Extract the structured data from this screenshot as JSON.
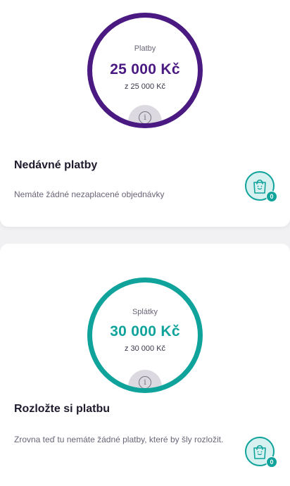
{
  "colors": {
    "purple": "#4a1a82",
    "teal": "#0fa39b",
    "background": "#f1f0f3"
  },
  "payments": {
    "gauge": {
      "label": "Platby",
      "amount": "25 000 Kč",
      "of_total": "z 25 000 Kč",
      "info_icon": "info-icon"
    },
    "title": "Nedávné platby",
    "text": "Nemáte žádné nezaplacené objednávky",
    "badge": {
      "icon": "shopping-bag-icon",
      "count": "0"
    }
  },
  "installments": {
    "gauge": {
      "label": "Splátky",
      "amount": "30 000 Kč",
      "of_total": "z 30 000 Kč",
      "info_icon": "info-icon"
    },
    "title": "Rozložte si platbu",
    "text": "Zrovna teď tu nemáte žádné platby, které by šly rozložit.",
    "badge": {
      "icon": "shopping-bag-icon",
      "count": "0"
    }
  }
}
